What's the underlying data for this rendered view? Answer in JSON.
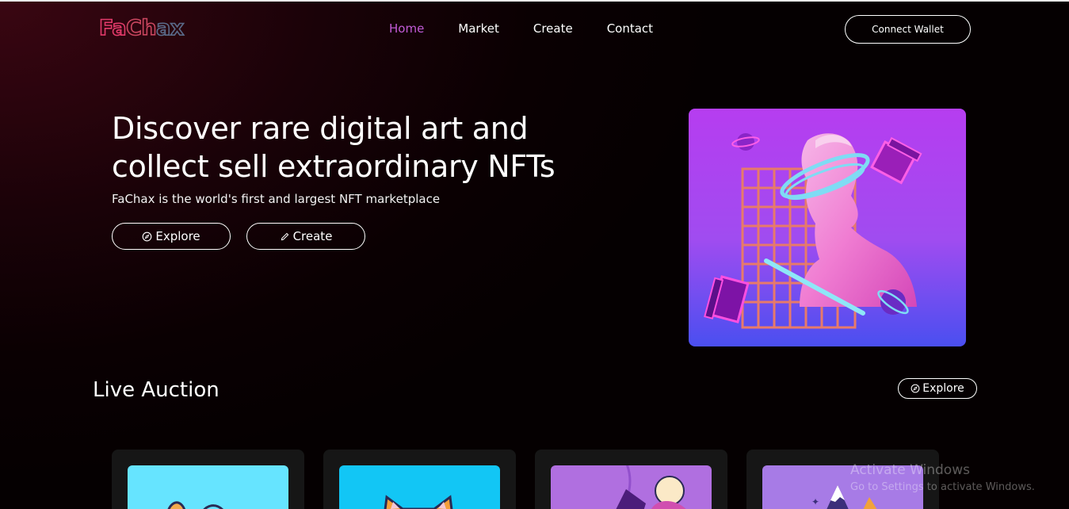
{
  "header": {
    "logo_parts": [
      "Fa",
      "Ch",
      "ax"
    ],
    "nav": [
      {
        "label": "Home",
        "active": true
      },
      {
        "label": "Market",
        "active": false
      },
      {
        "label": "Create",
        "active": false
      },
      {
        "label": "Contact",
        "active": false
      }
    ],
    "connect_label": "Connect Wallet"
  },
  "hero": {
    "title_line1": "Discover rare digital art and",
    "title_line2": "collect sell extraordinary NFTs",
    "subtitle": "FaChax is the world's first and largest NFT marketplace",
    "explore_label": "Explore",
    "create_label": "Create",
    "explore_icon": "compass-icon",
    "create_icon": "pencil-icon"
  },
  "live_auction": {
    "title": "Live Auction",
    "explore_label": "Explore",
    "cards": [
      {
        "thumb_color": "#66e4ff"
      },
      {
        "thumb_color": "#12c6f5"
      },
      {
        "thumb_color": "#b06fe0"
      },
      {
        "thumb_color": "#a77be6"
      }
    ]
  },
  "watermark": {
    "line1": "Activate Windows",
    "line2": "Go to Settings to activate Windows."
  },
  "colors": {
    "accent": "#c35bd6",
    "background": "#0a0002"
  }
}
